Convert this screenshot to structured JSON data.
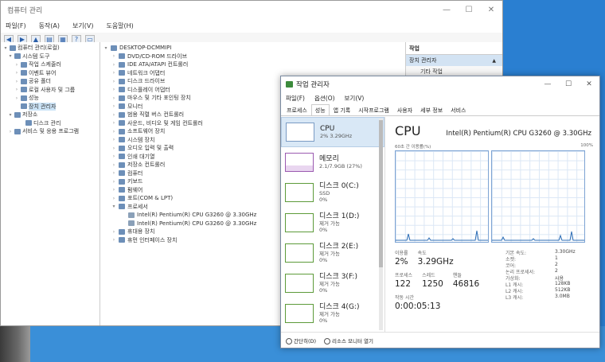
{
  "computer_management": {
    "title": "컴퓨터 관리",
    "window_controls": [
      "—",
      "☐",
      "✕"
    ],
    "menu": [
      "파일(F)",
      "동작(A)",
      "보기(V)",
      "도움말(H)"
    ],
    "tree": [
      {
        "label": "컴퓨터 관리(로컬)",
        "level": 0
      },
      {
        "label": "시스템 도구",
        "level": 1
      },
      {
        "label": "작업 스케줄러",
        "level": 2
      },
      {
        "label": "이벤트 뷰어",
        "level": 2
      },
      {
        "label": "공유 폴더",
        "level": 2
      },
      {
        "label": "로컬 사용자 및 그룹",
        "level": 2
      },
      {
        "label": "성능",
        "level": 2
      },
      {
        "label": "장치 관리자",
        "level": 2,
        "selected": true
      },
      {
        "label": "저장소",
        "level": 1
      },
      {
        "label": "디스크 관리",
        "level": 2
      },
      {
        "label": "서비스 및 응용 프로그램",
        "level": 1
      }
    ],
    "devices": {
      "root": "DESKTOP-DCMMIPI",
      "items": [
        "DVD/CD-ROM 드라이브",
        "IDE ATA/ATAPI 컨트롤러",
        "네트워크 어댑터",
        "디스크 드라이브",
        "디스플레이 어댑터",
        "마우스 및 기타 포인팅 장치",
        "모니터",
        "범용 직렬 버스 컨트롤러",
        "사운드, 비디오 및 게임 컨트롤러",
        "소프트웨어 장치",
        "시스템 장치",
        "오디오 입력 및 출력",
        "인쇄 대기열",
        "저장소 컨트롤러",
        "컴퓨터",
        "키보드",
        "펌웨어",
        "포트(COM & LPT)",
        "프로세서"
      ],
      "processors": [
        "Intel(R) Pentium(R) CPU G3260 @ 3.30GHz",
        "Intel(R) Pentium(R) CPU G3260 @ 3.30GHz"
      ],
      "after": [
        "휴대용 장치",
        "휴먼 인터페이스 장치"
      ]
    },
    "actions": {
      "header": "작업",
      "sub": "장치 관리자",
      "more": "기타 작업"
    }
  },
  "task_manager": {
    "title": "작업 관리자",
    "menu": [
      "파일(F)",
      "옵션(O)",
      "보기(V)"
    ],
    "tabs": [
      "프로세스",
      "성능",
      "앱 기록",
      "시작프로그램",
      "사용자",
      "세부 정보",
      "서비스"
    ],
    "active_tab": "성능",
    "resources": [
      {
        "name": "CPU",
        "sub1": "2% 3.29GHz",
        "sub2": "",
        "kind": "cpu"
      },
      {
        "name": "메모리",
        "sub1": "2.1/7.9GB (27%)",
        "sub2": "",
        "kind": "mem"
      },
      {
        "name": "디스크 0(C:)",
        "sub1": "SSD",
        "sub2": "0%",
        "kind": "disk"
      },
      {
        "name": "디스크 1(D:)",
        "sub1": "제거 가능",
        "sub2": "0%",
        "kind": "disk"
      },
      {
        "name": "디스크 2(E:)",
        "sub1": "제거 가능",
        "sub2": "0%",
        "kind": "disk"
      },
      {
        "name": "디스크 3(F:)",
        "sub1": "제거 가능",
        "sub2": "0%",
        "kind": "disk"
      },
      {
        "name": "디스크 4(G:)",
        "sub1": "제거 가능",
        "sub2": "0%",
        "kind": "disk"
      }
    ],
    "cpu": {
      "heading": "CPU",
      "model": "Intel(R) Pentium(R) CPU G3260 @ 3.30GHz",
      "graph_label": "60초 간 이용률(%)",
      "graph_max": "100%",
      "utilization_label": "이용률",
      "utilization": "2%",
      "speed_label": "속도",
      "speed": "3.29GHz",
      "processes_label": "프로세스",
      "processes": "122",
      "threads_label": "스레드",
      "threads": "1250",
      "handles_label": "핸들",
      "handles": "46816",
      "uptime_label": "작동 시간",
      "uptime": "0:00:05:13",
      "specs": [
        {
          "k": "기본 속도:",
          "v": "3.30GHz"
        },
        {
          "k": "소켓:",
          "v": "1"
        },
        {
          "k": "코어:",
          "v": "2"
        },
        {
          "k": "논리 프로세서:",
          "v": "2"
        },
        {
          "k": "가상화:",
          "v": "사용"
        },
        {
          "k": "L1 캐시:",
          "v": "128KB"
        },
        {
          "k": "L2 캐시:",
          "v": "512KB"
        },
        {
          "k": "L3 캐시:",
          "v": "3.0MB"
        }
      ]
    },
    "footer": {
      "less": "간단히(D)",
      "monitor": "리소스 모니터 열기"
    }
  }
}
